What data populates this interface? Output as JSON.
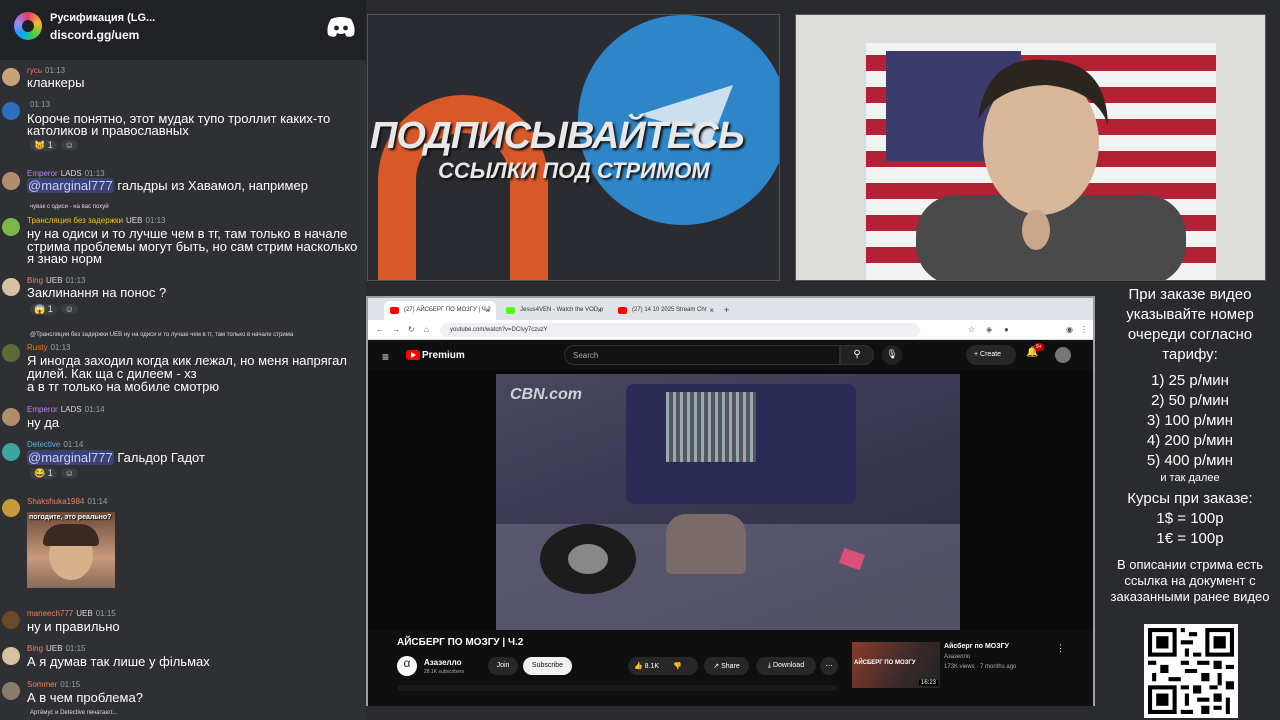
{
  "server": {
    "name": "Русификация (LG...",
    "invite": "discord.gg/uem"
  },
  "messages": [
    {
      "user": "гусь",
      "time": "01:13",
      "text": "кланкеры"
    },
    {
      "user": "",
      "time": "01:13",
      "lines": [
        "Короче понятно, этот мудак тупо троллит каких-то",
        "католиков и православных"
      ],
      "reactions": [
        "1"
      ]
    },
    {
      "user": "Emperor",
      "badge": "LADS",
      "time": "01:13",
      "mention": "@marginal777",
      "text": "гальдры из Хавамол, например"
    },
    {
      "reply": "чувак с одиси - на вас похуй",
      "user": "Трансляция без задержки",
      "badge": "UEB",
      "time": "01:13",
      "lines": [
        "ну на одиси и то лучше чем в тг, там только в начале",
        "стрима проблемы могут быть, но сам стрим насколько",
        "я знаю норм"
      ]
    },
    {
      "user": "Bing",
      "badge": "UEB",
      "time": "01:13",
      "text": "Заклинання на понос ?",
      "reactions": [
        "1"
      ]
    },
    {
      "reply": "@Трансляция без задержки UEB ну на одиси и то лучше чем в тг, там только в начале стрима",
      "user": "Rusty",
      "time": "01:13",
      "lines": [
        "Я иногда заходил когда кик лежал, но меня напрягал",
        "дилей. Как ща с дилеем - хз",
        "а в тг только на мобиле смотрю"
      ]
    },
    {
      "user": "Emperor",
      "badge": "LADS",
      "time": "01:14",
      "text": "ну да"
    },
    {
      "user": "Detective",
      "time": "01:14",
      "mention": "@marginal777",
      "text": "Гальдор Гадот",
      "reactions": [
        "1"
      ]
    },
    {
      "user": "Shakshuka1984",
      "time": "01:14",
      "image_caption": "погодите, это реально?"
    },
    {
      "user": "maneech777",
      "badge": "UEB",
      "time": "01:15",
      "text": "ну и правильно"
    },
    {
      "user": "Bing",
      "badge": "UEB",
      "time": "01:15",
      "text": "А я думав так лише у фільмах"
    },
    {
      "user": "Sommer",
      "time": "01:15",
      "text": "А в чем проблема?"
    }
  ],
  "typing": "Артёмус и Detective печатают...",
  "banner": {
    "line1": "ПОДПИСЫВАЙТЕСЬ",
    "line2": "ССЫЛКИ ПОД СТРИМОМ"
  },
  "browser": {
    "tabs": [
      "(27) АЙСБЕРГ ПО МОЗГУ | Ч.2",
      "Jesus4VEN - Watch the VOD o",
      "(27) 14 10 2025 Stream Chr"
    ],
    "url": "youtube.com/watch?v=DCIvy7czuzY"
  },
  "youtube": {
    "brand": "Premium",
    "search_placeholder": "Search",
    "create": "Create",
    "notif_count": "9+",
    "video_watermark": "CBN.com",
    "title": "АЙСБЕРГ ПО МОЗГУ | Ч.2",
    "channel": "Азазелло",
    "subscribers": "28.1K subscribers",
    "join": "Join",
    "subscribe": "Subscribe",
    "likes": "8.1K",
    "share": "Share",
    "download": "Download",
    "upnext": {
      "thumb_text": "АЙСБЕРГ ПО МОЗГУ",
      "duration": "16:23",
      "title": "Айсберг по МОЗГУ",
      "channel": "Азазелло",
      "meta": "173K views · 7 months ago"
    }
  },
  "info": {
    "order": "При заказе видео указывайте номер очереди согласно тарифу:",
    "tariffs": [
      "1) 25 р/мин",
      "2) 50 р/мин",
      "3) 100 р/мин",
      "4) 200 р/мин",
      "5) 400 р/мин"
    ],
    "etc": "и так далее",
    "rates_title": "Курсы при заказе:",
    "rates": [
      "1$ = 100р",
      "1€ = 100р"
    ],
    "desc": "В описании стрима есть ссылка на документ с заказанными ранее видео"
  }
}
